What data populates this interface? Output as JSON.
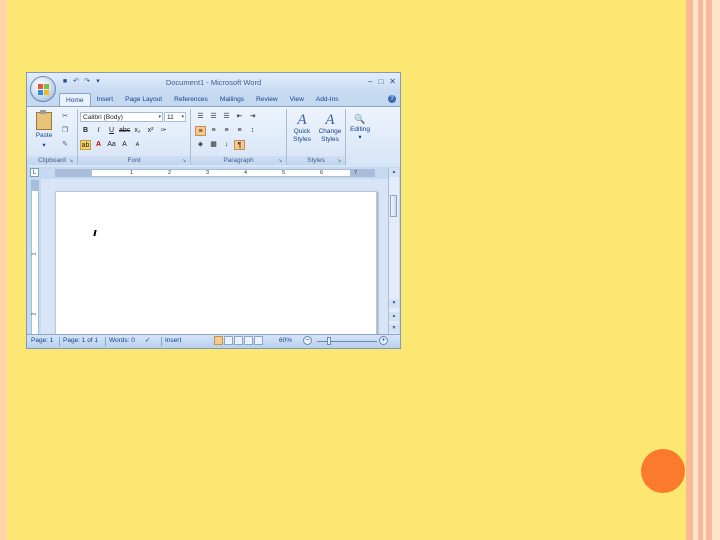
{
  "window": {
    "title": "Document1 - Microsoft Word",
    "min_glyph": "–",
    "max_glyph": "□",
    "close_glyph": "✕"
  },
  "qat": {
    "save_glyph": "■",
    "undo_glyph": "↶",
    "redo_glyph": "↷",
    "customize_glyph": "▾"
  },
  "tabs": [
    "Home",
    "Insert",
    "Page Layout",
    "References",
    "Mailings",
    "Review",
    "View",
    "Add-Ins"
  ],
  "ribbon": {
    "clipboard": {
      "paste_label": "Paste",
      "paste_arrow": "▾",
      "group_label": "Clipboard",
      "cut_glyph": "✂",
      "copy_glyph": "❐",
      "painter_glyph": "✎"
    },
    "font": {
      "font_name": "Calibri (Body)",
      "font_size": "11",
      "grow_glyph": "A",
      "shrink_glyph": "A",
      "bold": "B",
      "italic": "I",
      "underline": "U",
      "strike": "abc",
      "subscript": "x₂",
      "superscript": "x²",
      "clear_glyph": "✑",
      "change_case": "Aa",
      "grow2": "A",
      "shrink2": "A",
      "font_color_glyph": "A",
      "group_label": "Font"
    },
    "paragraph": {
      "group_label": "Paragraph",
      "sort_glyph": "↓",
      "pilcrow_glyph": "¶"
    },
    "styles": {
      "quick_styles": "Quick",
      "quick_styles_2": "Styles",
      "change_styles": "Change",
      "change_styles_2": "Styles",
      "group_label": "Styles"
    },
    "editing": {
      "label": "Editing"
    }
  },
  "ruler": {
    "tab_glyph": "L",
    "numbers": [
      "1",
      "2",
      "3",
      "4",
      "5",
      "6",
      "7"
    ]
  },
  "vruler": {
    "numbers": [
      "1",
      "2"
    ]
  },
  "status": {
    "page": "Page: 1",
    "page_of": "Page: 1 of 1",
    "words": "Words: 0",
    "mode": "Insert",
    "zoom": "60%"
  },
  "colors": {
    "slide_bg": "#FCE772",
    "accent_dot": "#FB7A2E",
    "ribbon_blue": "#C5D9F1"
  }
}
